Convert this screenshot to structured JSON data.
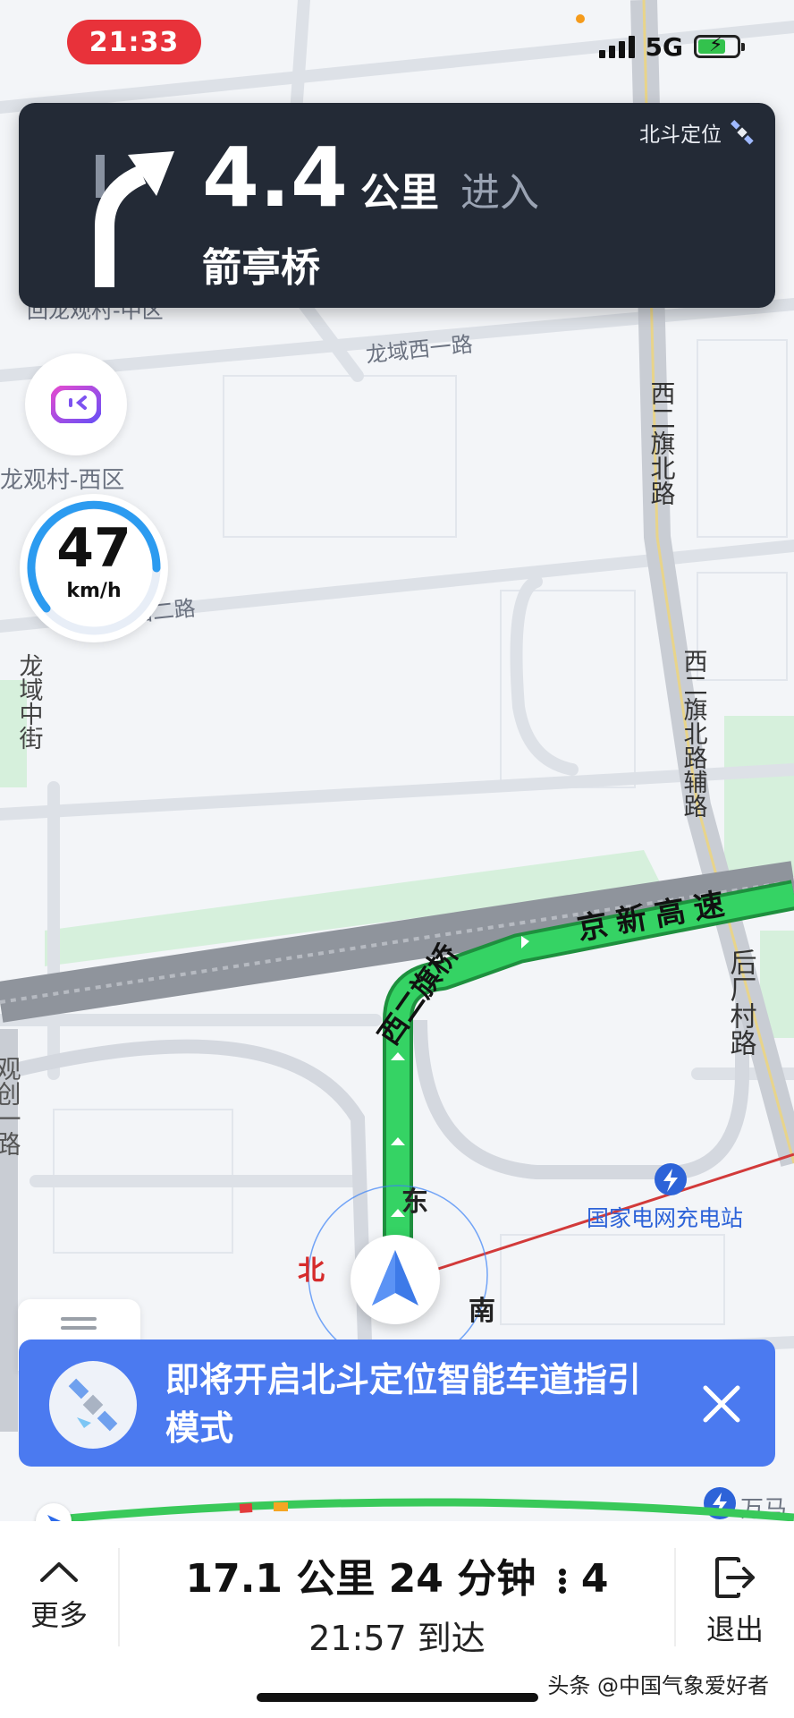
{
  "status_bar": {
    "time": "21:33",
    "network": "5G"
  },
  "nav_card": {
    "beidou_label": "北斗定位",
    "distance": "4.4",
    "unit": "公里",
    "action": "进入",
    "road": "箭亭桥"
  },
  "speed": {
    "value": "47",
    "unit": "km/h"
  },
  "map": {
    "labels": {
      "top_partial": "回龙观村-中区",
      "longyu_west1": "龙域西一路",
      "xierqi_north": "西二旗北路",
      "west_area": "龙观村-西区",
      "longyu_west2": "龙域西二路",
      "longyu_middle": "龙域中街",
      "xierqi_aux": "西二旗北路辅路",
      "jingxin_highway": "京新高速",
      "xierqi_bridge": "西二旗桥",
      "houchang_road": "后厂村路",
      "left_vertical": "观创一路",
      "charging_station": "国家电网充电站",
      "wanma": "万马"
    },
    "compass": {
      "east": "东",
      "north": "北",
      "south": "南"
    }
  },
  "banner": {
    "text": "即将开启北斗定位智能车道指引模式"
  },
  "bottom": {
    "more_label": "更多",
    "summary": "17.1 公里 24 分钟",
    "lights": "4",
    "arrival": "21:57 到达",
    "exit_label": "退出"
  },
  "watermark": "头条 @中国气象爱好者",
  "colors": {
    "route": "#2ecc5a",
    "card": "#232a36",
    "banner": "#4b7af0",
    "time_pill": "#e8323a"
  }
}
